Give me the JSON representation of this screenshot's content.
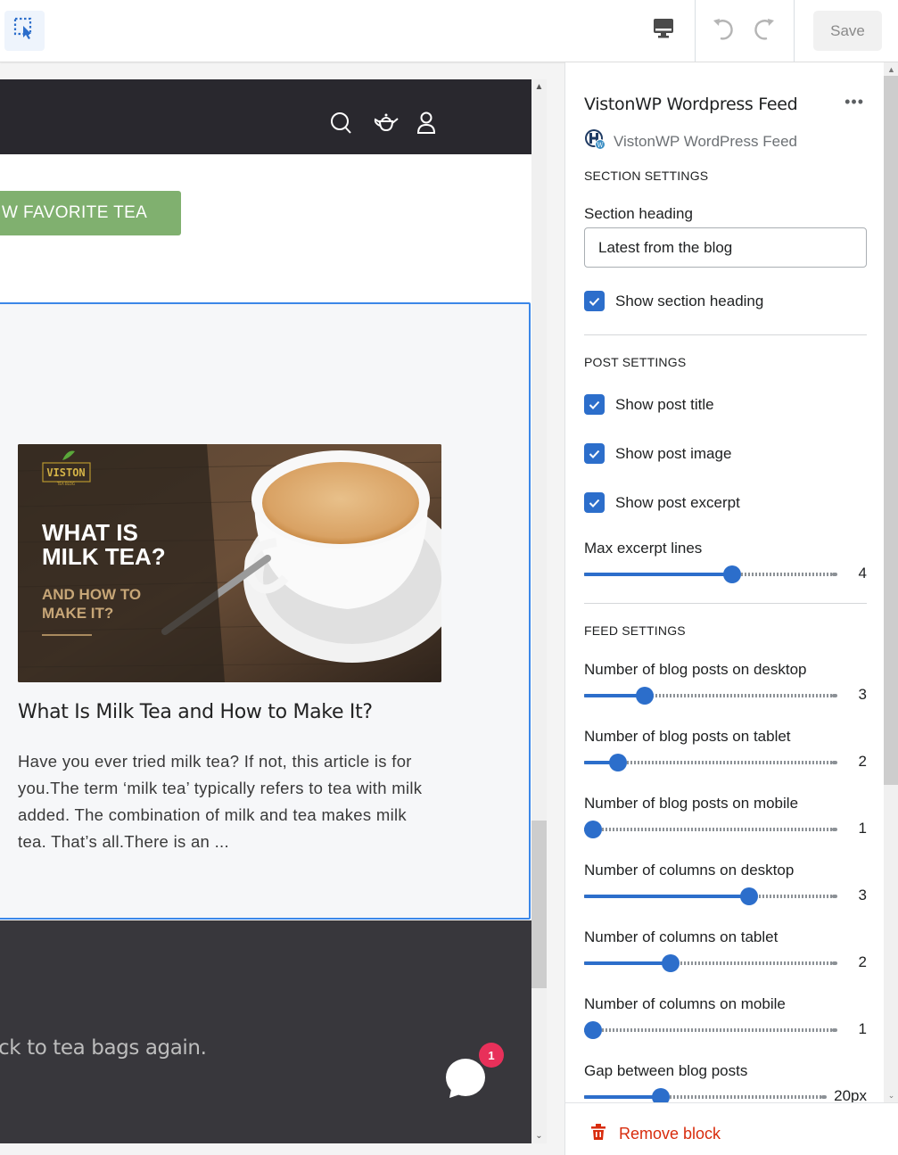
{
  "toolbar": {
    "select_tool_icon": "select-pointer-icon",
    "device_icon": "desktop-monitor-icon",
    "undo_icon": "undo-icon",
    "redo_icon": "redo-icon",
    "save_label": "Save"
  },
  "preview": {
    "header_icons": [
      "search-icon",
      "teapot-cart-icon",
      "user-account-icon"
    ],
    "cta_label": "W FAVORITE TEA",
    "post": {
      "image_brand": "VISTON",
      "image_brand_sub": "TEA BLOG",
      "image_headline_1": "WHAT IS",
      "image_headline_2": "MILK TEA?",
      "image_sub_1": "AND HOW TO",
      "image_sub_2": "MAKE IT?",
      "title": "What Is Milk Tea and How to Make It?",
      "excerpt": "Have you ever tried milk tea? If not, this article is for you.The term ‘milk tea’ typically refers to tea with milk added. The combination of milk and tea makes milk tea. That’s all.There is an ..."
    },
    "footer_text": "ck to tea bags again.",
    "chat_badge_count": "1"
  },
  "panel": {
    "block_title": "VistonWP Wordpress Feed",
    "more_label": "•••",
    "app_name": "VistonWP WordPress Feed",
    "section_settings": {
      "heading": "SECTION SETTINGS",
      "section_heading_label": "Section heading",
      "section_heading_value": "Latest from the blog",
      "show_section_heading_label": "Show section heading",
      "show_section_heading": true
    },
    "post_settings": {
      "heading": "POST SETTINGS",
      "checkboxes": [
        {
          "label": "Show post title",
          "checked": true
        },
        {
          "label": "Show post image",
          "checked": true
        },
        {
          "label": "Show post excerpt",
          "checked": true
        }
      ],
      "max_excerpt_lines": {
        "label": "Max excerpt lines",
        "value": "4",
        "fraction": 0.59
      }
    },
    "feed_settings": {
      "heading": "FEED SETTINGS",
      "sliders": [
        {
          "label": "Number of blog posts on desktop",
          "value": "3",
          "fraction": 0.24
        },
        {
          "label": "Number of blog posts on tablet",
          "value": "2",
          "fraction": 0.135
        },
        {
          "label": "Number of blog posts on mobile",
          "value": "1",
          "fraction": 0.0
        },
        {
          "label": "Number of columns on desktop",
          "value": "3",
          "fraction": 0.655
        },
        {
          "label": "Number of columns on tablet",
          "value": "2",
          "fraction": 0.345
        },
        {
          "label": "Number of columns on mobile",
          "value": "1",
          "fraction": 0.0
        },
        {
          "label": "Gap between blog posts",
          "value": "20px",
          "fraction": 0.32
        }
      ]
    },
    "remove_label": "Remove block"
  },
  "colors": {
    "accent": "#2c6ecb",
    "danger": "#d82c0d",
    "cta_green": "#80b06f",
    "selection_outline": "#3b87e8",
    "site_header": "#29282e",
    "badge": "#e8305a"
  }
}
